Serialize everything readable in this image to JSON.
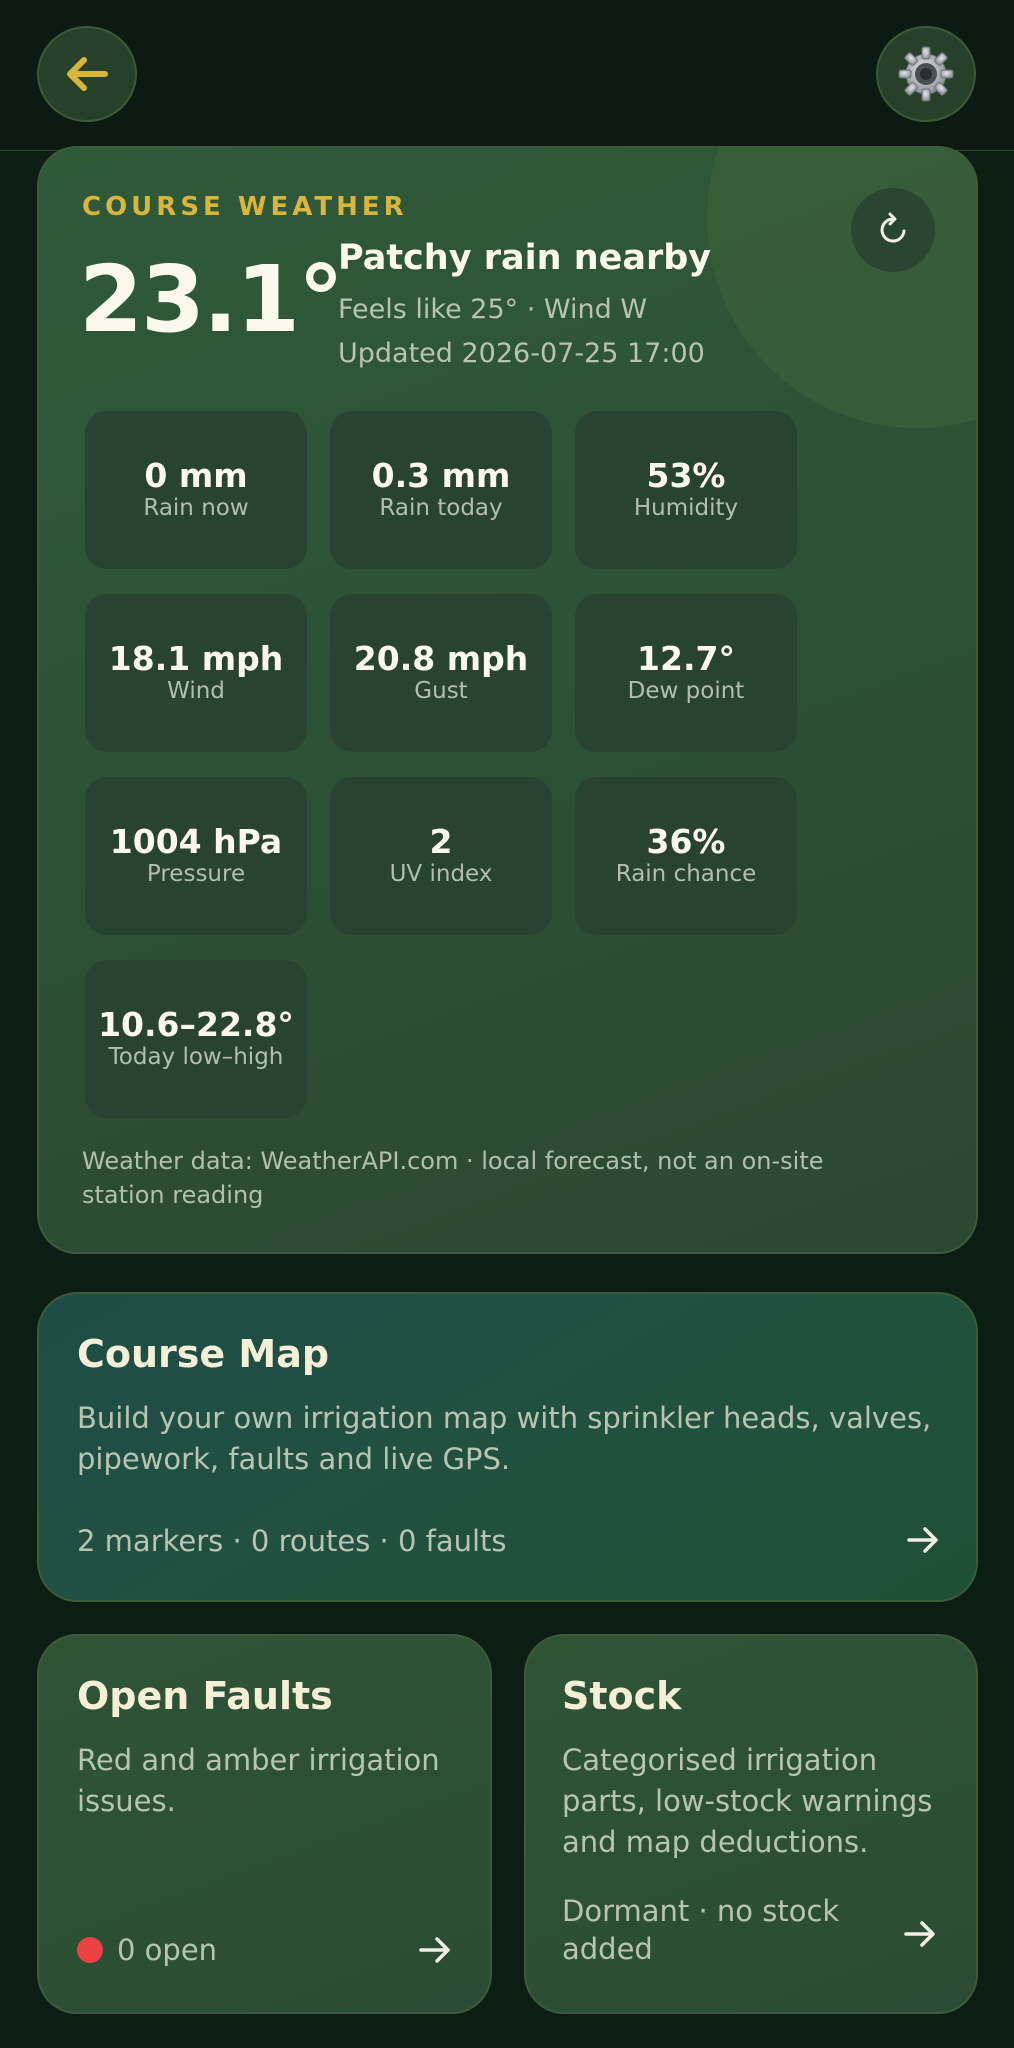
{
  "header": {
    "back_icon": "arrow-left-icon",
    "settings_icon": "gear-icon",
    "accent": "#d9b53c"
  },
  "weather": {
    "eyebrow": "COURSE WEATHER",
    "temperature": "23.1°",
    "condition": "Patchy rain nearby",
    "feels_like": "Feels like 25° · Wind W",
    "updated": "Updated 2026-07-25 17:00",
    "refresh_icon": "refresh-icon",
    "tiles": [
      {
        "value": "0 mm",
        "label": "Rain now"
      },
      {
        "value": "0.3 mm",
        "label": "Rain today"
      },
      {
        "value": "53%",
        "label": "Humidity"
      },
      {
        "value": "18.1 mph",
        "label": "Wind"
      },
      {
        "value": "20.8 mph",
        "label": "Gust"
      },
      {
        "value": "12.7°",
        "label": "Dew point"
      },
      {
        "value": "1004 hPa",
        "label": "Pressure"
      },
      {
        "value": "2",
        "label": "UV index"
      },
      {
        "value": "36%",
        "label": "Rain chance"
      },
      {
        "value": "10.6–22.8°",
        "label": "Today low–high"
      }
    ],
    "source": "Weather data: WeatherAPI.com · local forecast, not an on-site station reading"
  },
  "course_map": {
    "title": "Course Map",
    "description": "Build your own irrigation map with sprinkler heads, valves, pipework, faults and live GPS.",
    "summary": "2 markers · 0 routes · 0 faults"
  },
  "open_faults": {
    "title": "Open Faults",
    "description": "Red and amber irrigation issues.",
    "count": "0 open",
    "status_color": "#ea4242"
  },
  "stock": {
    "title": "Stock",
    "description": "Categorised irrigation parts, low-stock warnings and map deductions.",
    "status": "Dormant · no stock added"
  }
}
